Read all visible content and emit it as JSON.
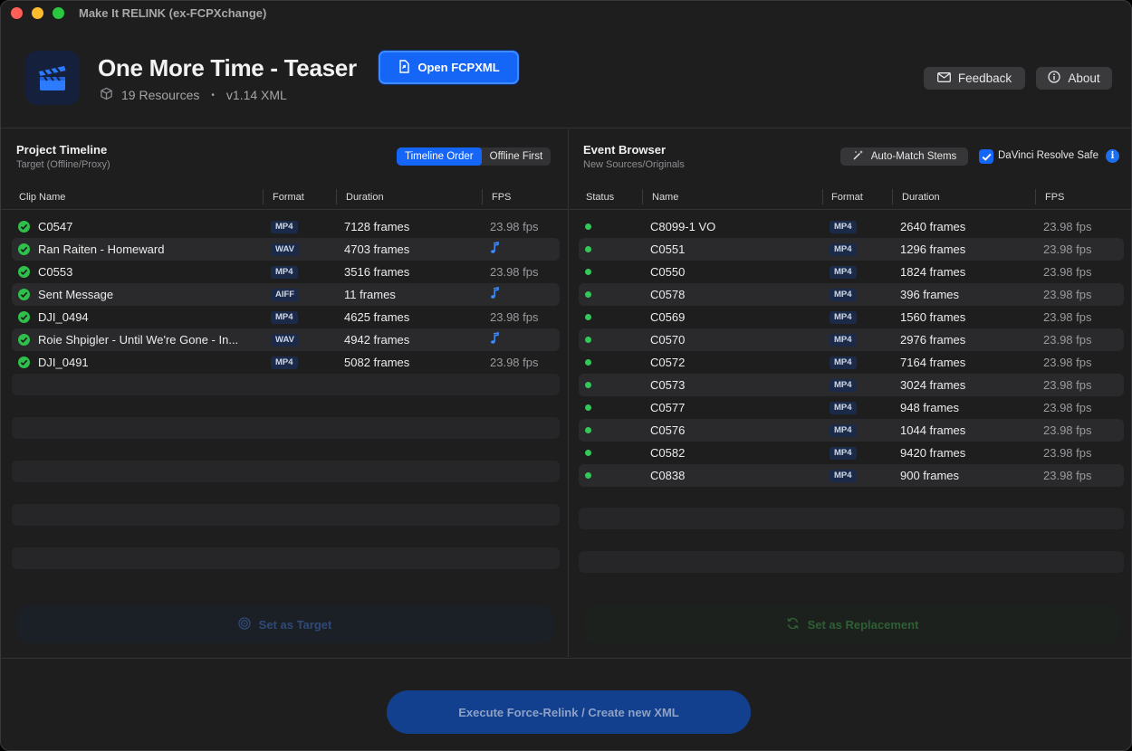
{
  "window": {
    "title": "Make It RELINK (ex-FCPXchange)"
  },
  "header": {
    "project_title": "One More Time - Teaser",
    "resources": "19 Resources",
    "separator": "•",
    "xml_version": "v1.14 XML",
    "open_label": "Open FCPXML",
    "feedback_label": "Feedback",
    "about_label": "About"
  },
  "timeline": {
    "title": "Project Timeline",
    "subtitle": "Target (Offline/Proxy)",
    "sort_options": [
      "Timeline Order",
      "Offline First"
    ],
    "sort_selected": "Timeline Order",
    "columns": [
      "Clip Name",
      "Format",
      "Duration",
      "FPS"
    ],
    "rows": [
      {
        "name": "C0547",
        "format": "MP4",
        "duration": "7128 frames",
        "fps": "23.98 fps",
        "audio": false
      },
      {
        "name": "Ran Raiten - Homeward",
        "format": "WAV",
        "duration": "4703 frames",
        "fps": "",
        "audio": true
      },
      {
        "name": "C0553",
        "format": "MP4",
        "duration": "3516 frames",
        "fps": "23.98 fps",
        "audio": false
      },
      {
        "name": "Sent Message",
        "format": "AIFF",
        "duration": "11 frames",
        "fps": "",
        "audio": true
      },
      {
        "name": "DJI_0494",
        "format": "MP4",
        "duration": "4625 frames",
        "fps": "23.98 fps",
        "audio": false
      },
      {
        "name": "Roie Shpigler - Until We're Gone - In...",
        "format": "WAV",
        "duration": "4942 frames",
        "fps": "",
        "audio": true
      },
      {
        "name": "DJI_0491",
        "format": "MP4",
        "duration": "5082 frames",
        "fps": "23.98 fps",
        "audio": false
      }
    ],
    "action_label": "Set as Target"
  },
  "browser": {
    "title": "Event Browser",
    "subtitle": "New Sources/Originals",
    "auto_match_label": "Auto-Match Stems",
    "davinci_label": "DaVinci Resolve Safe",
    "davinci_checked": true,
    "columns": [
      "Status",
      "Name",
      "Format",
      "Duration",
      "FPS"
    ],
    "rows": [
      {
        "name": "C8099-1 VO",
        "format": "MP4",
        "duration": "2640 frames",
        "fps": "23.98 fps"
      },
      {
        "name": "C0551",
        "format": "MP4",
        "duration": "1296 frames",
        "fps": "23.98 fps"
      },
      {
        "name": "C0550",
        "format": "MP4",
        "duration": "1824 frames",
        "fps": "23.98 fps"
      },
      {
        "name": "C0578",
        "format": "MP4",
        "duration": "396 frames",
        "fps": "23.98 fps"
      },
      {
        "name": "C0569",
        "format": "MP4",
        "duration": "1560 frames",
        "fps": "23.98 fps"
      },
      {
        "name": "C0570",
        "format": "MP4",
        "duration": "2976 frames",
        "fps": "23.98 fps"
      },
      {
        "name": "C0572",
        "format": "MP4",
        "duration": "7164 frames",
        "fps": "23.98 fps"
      },
      {
        "name": "C0573",
        "format": "MP4",
        "duration": "3024 frames",
        "fps": "23.98 fps"
      },
      {
        "name": "C0577",
        "format": "MP4",
        "duration": "948 frames",
        "fps": "23.98 fps"
      },
      {
        "name": "C0576",
        "format": "MP4",
        "duration": "1044 frames",
        "fps": "23.98 fps"
      },
      {
        "name": "C0582",
        "format": "MP4",
        "duration": "9420 frames",
        "fps": "23.98 fps"
      },
      {
        "name": "C0838",
        "format": "MP4",
        "duration": "900 frames",
        "fps": "23.98 fps"
      }
    ],
    "action_label": "Set as Replacement"
  },
  "footer": {
    "execute_label": "Execute Force-Relink / Create new XML"
  },
  "colors": {
    "accent": "#1565f6",
    "online": "#34c759",
    "ok": "#2fbf4b",
    "window_bg": "#1e1e1f"
  }
}
